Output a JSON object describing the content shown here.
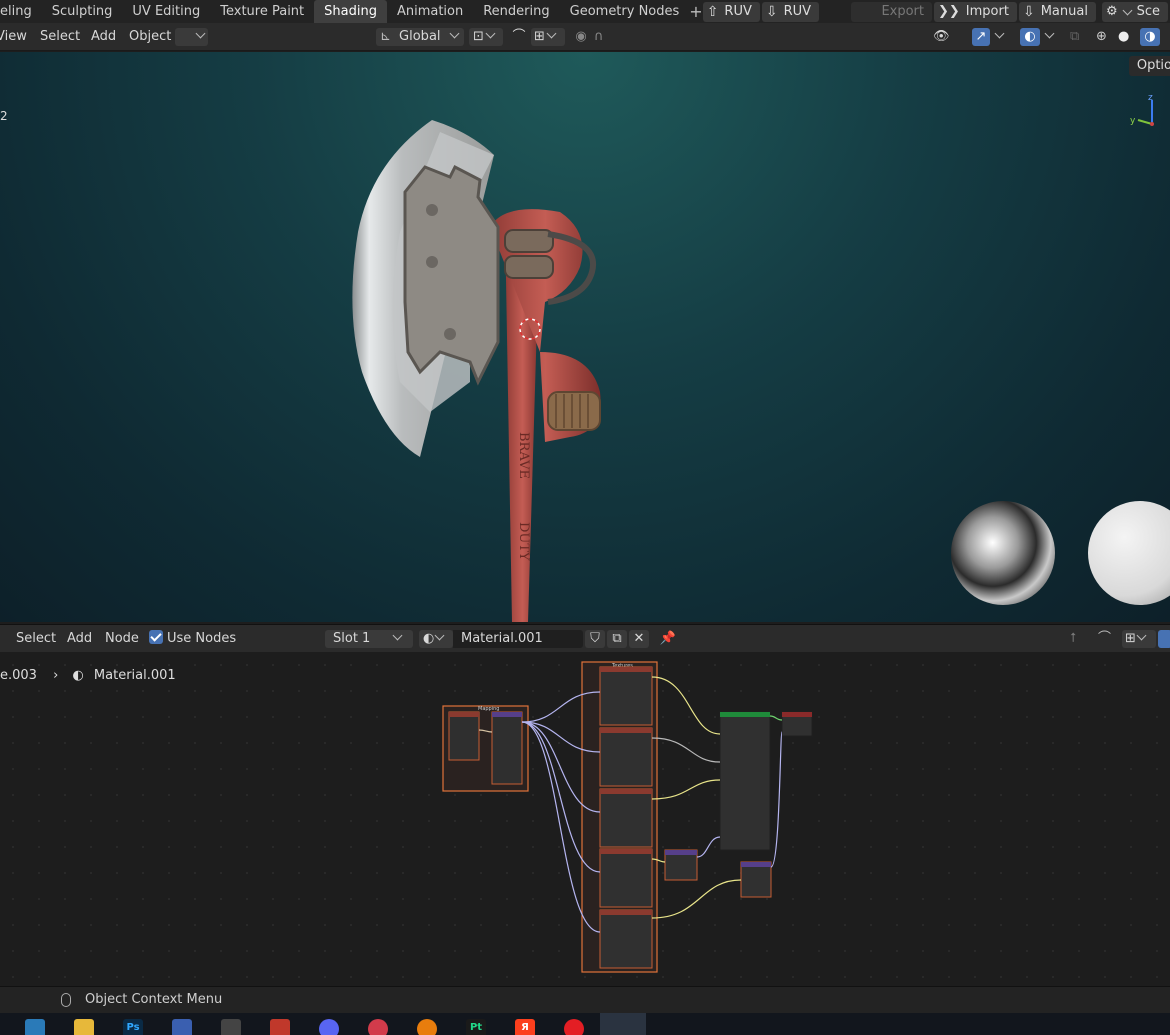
{
  "workspace_tabs": [
    "eling",
    "Sculpting",
    "UV Editing",
    "Texture Paint",
    "Shading",
    "Animation",
    "Rendering",
    "Geometry Nodes"
  ],
  "active_tab": "Shading",
  "addon_buttons": {
    "ruv1": "RUV",
    "ruv2": "RUV",
    "export": "Export",
    "import": "Import",
    "manual": "Manual",
    "scene": "Sce"
  },
  "viewport_header": {
    "view": "View",
    "select": "Select",
    "add": "Add",
    "object": "Object",
    "transform_orientation": "Global",
    "options": "Optio",
    "frame_num": "2"
  },
  "node_header": {
    "select": "Select",
    "add": "Add",
    "node": "Node",
    "use_nodes": "Use Nodes",
    "slot": "Slot 1",
    "material": "Material.001"
  },
  "breadcrumb": {
    "object": "e.003",
    "material": "Material.001"
  },
  "status": {
    "context_menu": "Object Context Menu"
  },
  "nodes": {
    "frame_left_label": "Mapping",
    "frame_main_label": "Textures"
  },
  "taskbar_icons": [
    "windows",
    "explorer",
    "photoshop",
    "blue-app",
    "calculator",
    "substance",
    "discord",
    "red-app",
    "blender",
    "pycharm",
    "yandex",
    "yandex-browser",
    "blender"
  ],
  "taskbar_labels": {
    "ps": "Ps",
    "pc": "Pt",
    "y": "Я"
  },
  "colors": {
    "accent": "#4772b3",
    "node_frame": "#e0733a",
    "handle_red": "#b84a43",
    "axe_blade": "#cfd2d4"
  }
}
